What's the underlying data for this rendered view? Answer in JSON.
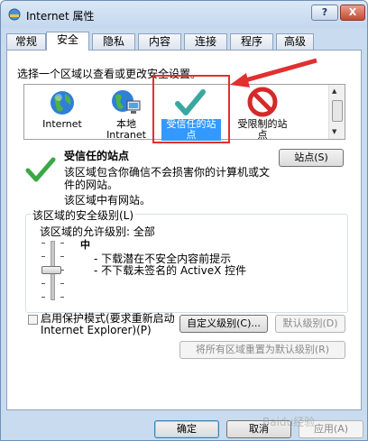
{
  "window": {
    "title": "Internet 属性",
    "help": "?",
    "close": "X"
  },
  "tabs": [
    {
      "label": "常规",
      "active": false
    },
    {
      "label": "安全",
      "active": true
    },
    {
      "label": "隐私",
      "active": false
    },
    {
      "label": "内容",
      "active": false
    },
    {
      "label": "连接",
      "active": false
    },
    {
      "label": "程序",
      "active": false
    },
    {
      "label": "高级",
      "active": false
    }
  ],
  "security": {
    "prompt": "选择一个区域以查看或更改安全设置。",
    "zones": [
      {
        "label": "Internet",
        "icon": "globe-icon",
        "selected": false
      },
      {
        "label": "本地\nIntranet",
        "icon": "network-globe-icon",
        "selected": false
      },
      {
        "label": "受信任的站\n点",
        "icon": "checkmark-icon",
        "selected": true
      },
      {
        "label": "受限制的站\n点",
        "icon": "no-entry-icon",
        "selected": false
      }
    ],
    "zone_title": "受信任的站点",
    "sites_button": "站点(S)",
    "description_line1": "该区域包含你确信不会损害你的计算机或文",
    "description_line2": "件的网站。",
    "sites_info": "该区域中有网站。",
    "level_group": "该区域的安全级别(L)",
    "allowed_levels": "该区域的允许级别: 全部",
    "level_name": "中",
    "level_bullets": [
      "- 下载潜在不安全内容前提示",
      "- 不下载未签名的 ActiveX 控件"
    ],
    "slider_level": 0.5,
    "protected_mode_line1": "启用保护模式(要求重新启动",
    "protected_mode_line2": "Internet Explorer)(P)",
    "protected_mode_checked": false,
    "custom_level_button": "自定义级别(C)...",
    "default_level_button": "默认级别(D)",
    "reset_all_button": "将所有区域重置为默认级别(R)"
  },
  "footer": {
    "ok": "确定",
    "cancel": "取消",
    "apply": "应用(A)"
  },
  "watermark": "Baidu经验",
  "colors": {
    "selection": "#3399ff",
    "annotation": "#e03030",
    "check_green": "#3aa845"
  }
}
